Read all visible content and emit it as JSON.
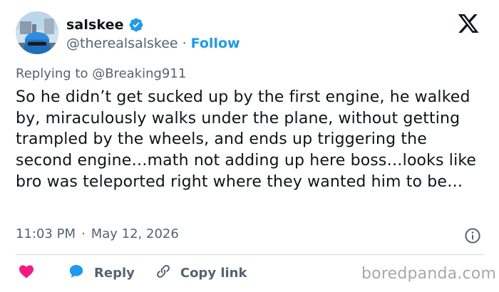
{
  "author": {
    "display_name": "salskee",
    "handle": "@therealsalskee",
    "separator": "·",
    "follow_label": "Follow",
    "verified_color": "#1d9bf0"
  },
  "reply_context": {
    "prefix": "Replying to",
    "mention": "@Breaking911"
  },
  "tweet": {
    "text": "So he didn’t get sucked up by the first engine, he walked by, miraculously walks under the plane, without getting trampled by the wheels, and ends up triggering the second engine…math not adding up here boss…looks like bro was teleported right where they wanted him to be…",
    "time": "11:03 PM",
    "separator": "·",
    "date": "May 12, 2026"
  },
  "actions": {
    "like_icon": "heart-icon",
    "like_color": "#f91880",
    "reply_label": "Reply",
    "reply_icon": "speech-bubble-icon",
    "reply_color": "#1d9bf0",
    "copy_link_label": "Copy link",
    "copy_link_icon": "link-icon"
  },
  "watermark": "boredpanda.com",
  "icons": {
    "logo": "x-logo-icon",
    "info": "info-icon",
    "verified": "verified-badge-icon"
  }
}
